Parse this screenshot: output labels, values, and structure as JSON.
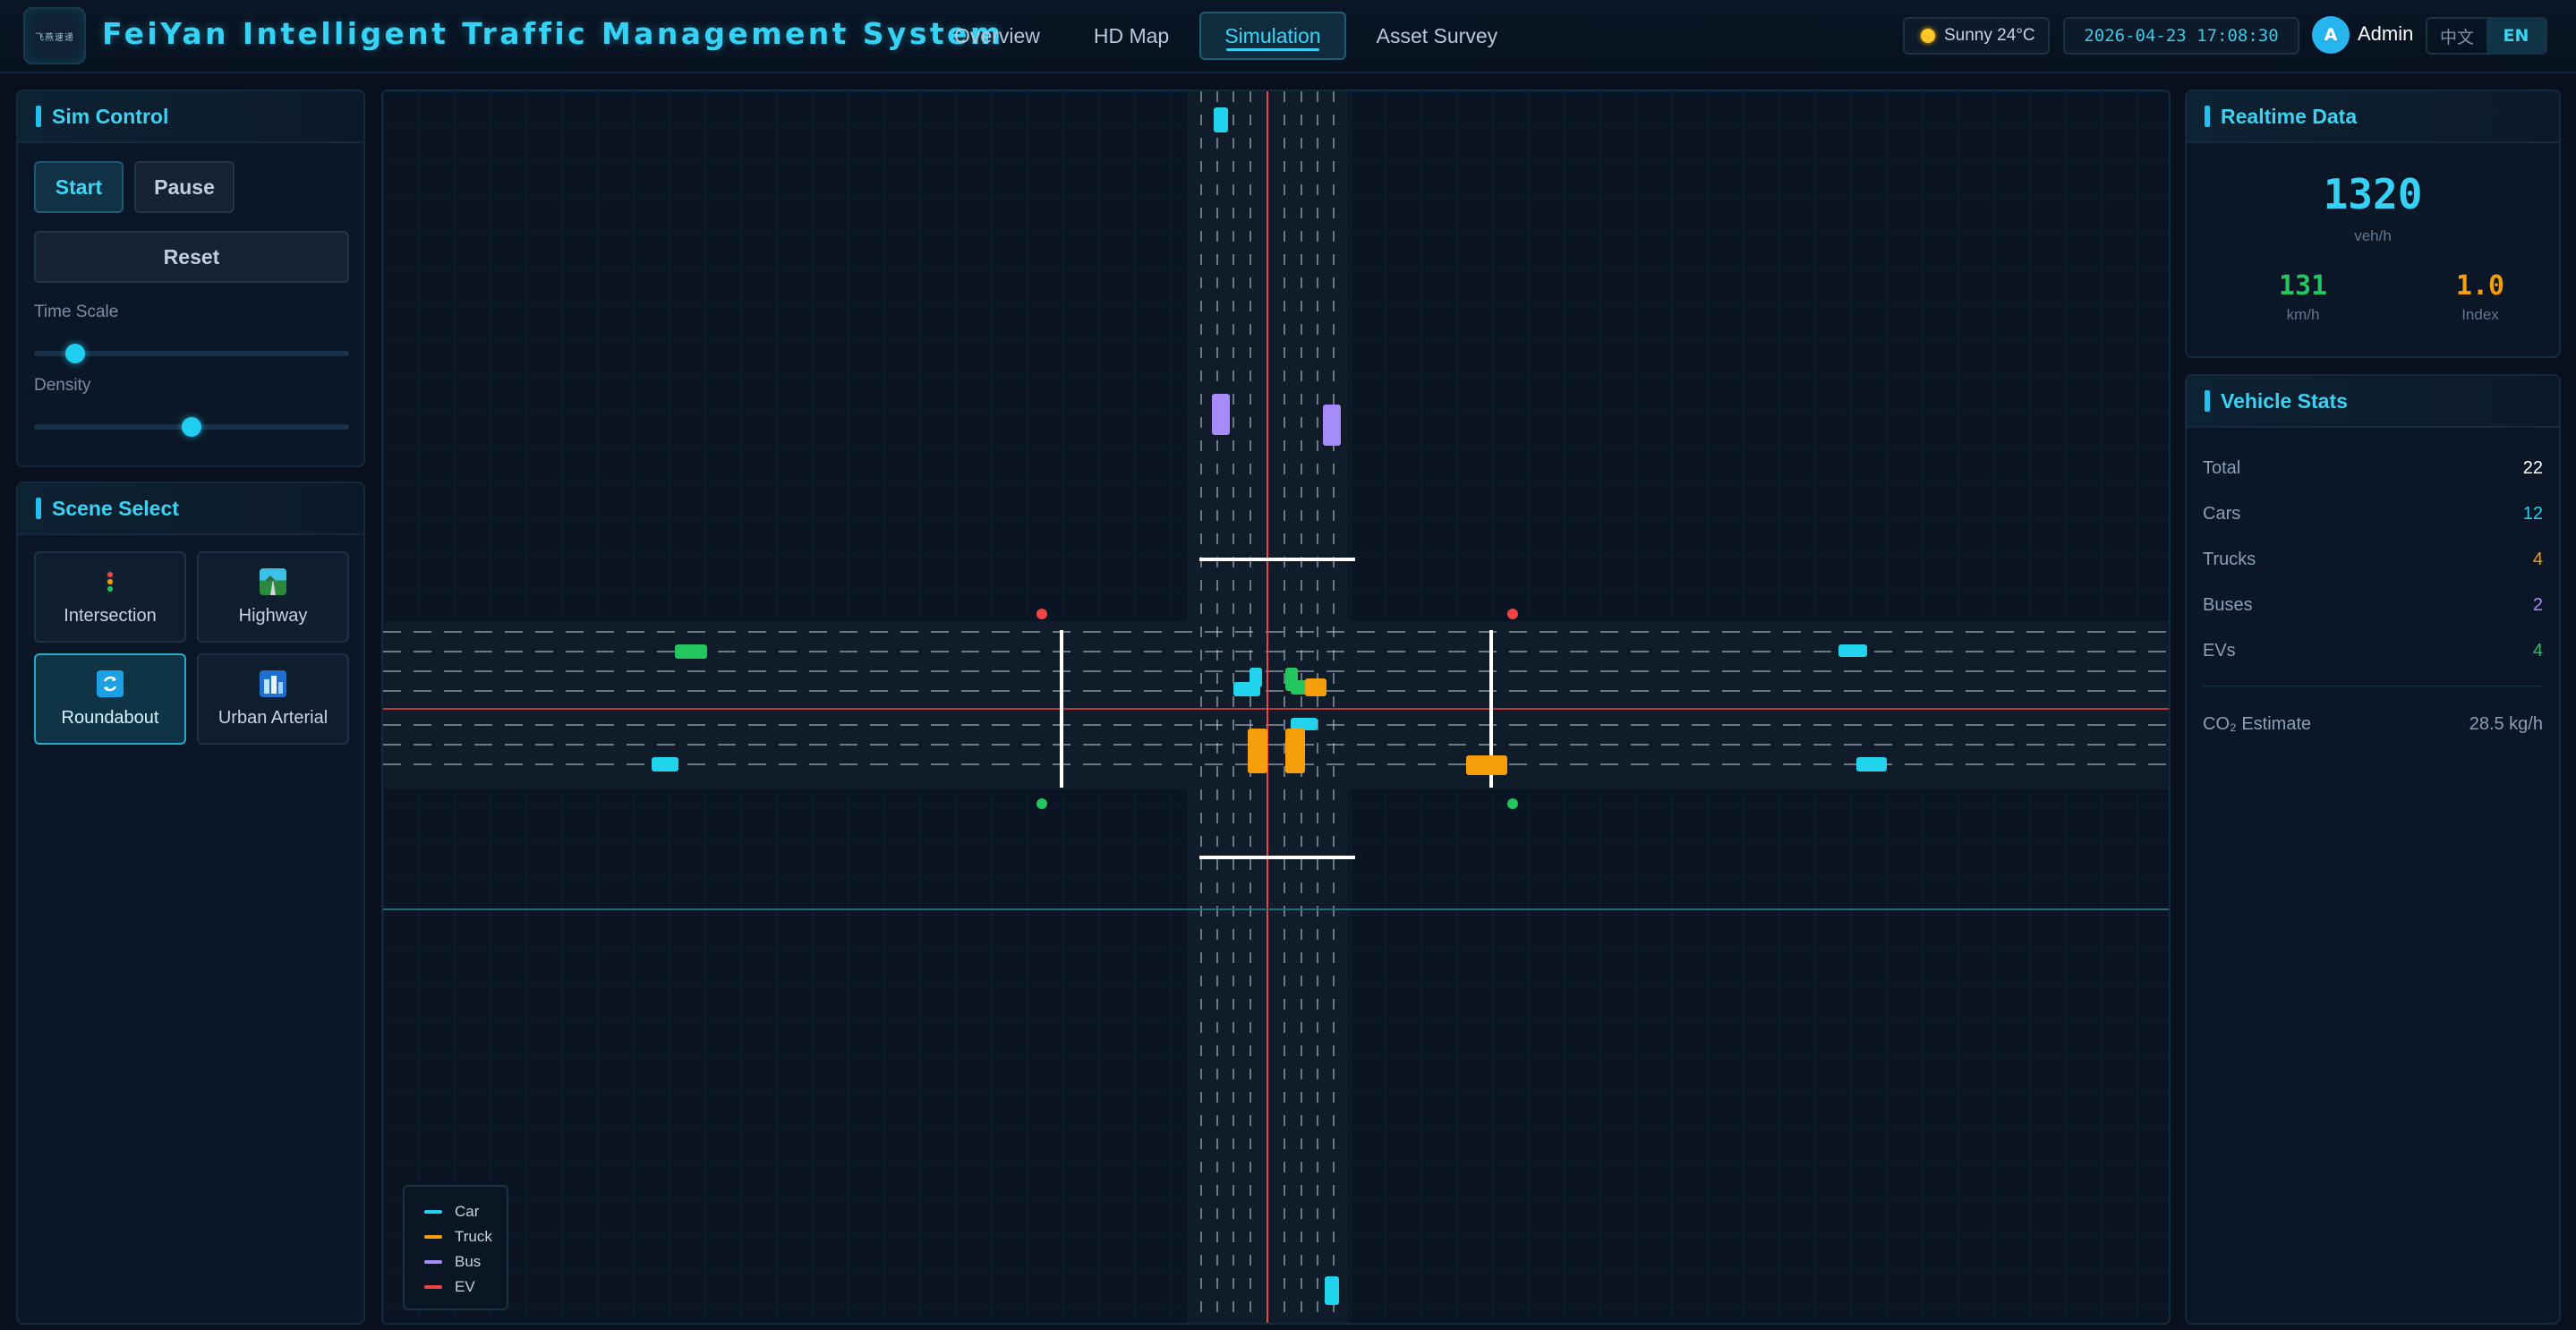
{
  "header": {
    "logo_text": "飞燕速递",
    "title": "FeiYan Intelligent Traffic Management System",
    "nav": [
      {
        "label": "Overview",
        "active": false
      },
      {
        "label": "HD Map",
        "active": false
      },
      {
        "label": "Simulation",
        "active": true
      },
      {
        "label": "Asset Survey",
        "active": false
      }
    ],
    "weather": "Sunny 24°C",
    "datetime": "2026-04-23 17:08:30",
    "avatar_initial": "A",
    "user": "Admin",
    "lang": {
      "zh": "中文",
      "en": "EN",
      "active": "EN"
    }
  },
  "sim_control": {
    "title": "Sim Control",
    "start_label": "Start",
    "pause_label": "Pause",
    "reset_label": "Reset",
    "time_scale_label": "Time Scale",
    "time_scale_value": 0.13,
    "density_label": "Density",
    "density_value": 0.5
  },
  "scene_select": {
    "title": "Scene Select",
    "scenes": [
      {
        "label": "Intersection",
        "icon": "traffic-light-icon",
        "active": false
      },
      {
        "label": "Highway",
        "icon": "highway-icon",
        "active": false
      },
      {
        "label": "Roundabout",
        "icon": "roundabout-icon",
        "active": true
      },
      {
        "label": "Urban Arterial",
        "icon": "city-icon",
        "active": false
      }
    ]
  },
  "legend": [
    {
      "label": "Car",
      "color": "#22d3ee"
    },
    {
      "label": "Truck",
      "color": "#f59e0b"
    },
    {
      "label": "Bus",
      "color": "#a78bfa"
    },
    {
      "label": "EV",
      "color": "#ef4444"
    }
  ],
  "realtime": {
    "title": "Realtime Data",
    "flow": "1320",
    "flow_unit": "veh/h",
    "speed": "131",
    "speed_unit": "km/h",
    "index": "1.0",
    "index_label": "Index"
  },
  "vehicle_stats": {
    "title": "Vehicle Stats",
    "rows": [
      {
        "label": "Total",
        "value": "22",
        "color": "#ffffff"
      },
      {
        "label": "Cars",
        "value": "12",
        "color": "#22d3ee"
      },
      {
        "label": "Trucks",
        "value": "4",
        "color": "#f59e0b"
      },
      {
        "label": "Buses",
        "value": "2",
        "color": "#a78bfa"
      },
      {
        "label": "EVs",
        "value": "4",
        "color": "#22c55e"
      }
    ],
    "co2_label": "CO₂ Estimate",
    "co2_value": "28.5 kg/h"
  },
  "colors": {
    "accent": "#36d2f5",
    "car": "#22d3ee",
    "truck": "#f59e0b",
    "bus": "#a78bfa",
    "ev": "#22c55e",
    "signal_red": "#ef4444",
    "signal_green": "#22c55e"
  }
}
